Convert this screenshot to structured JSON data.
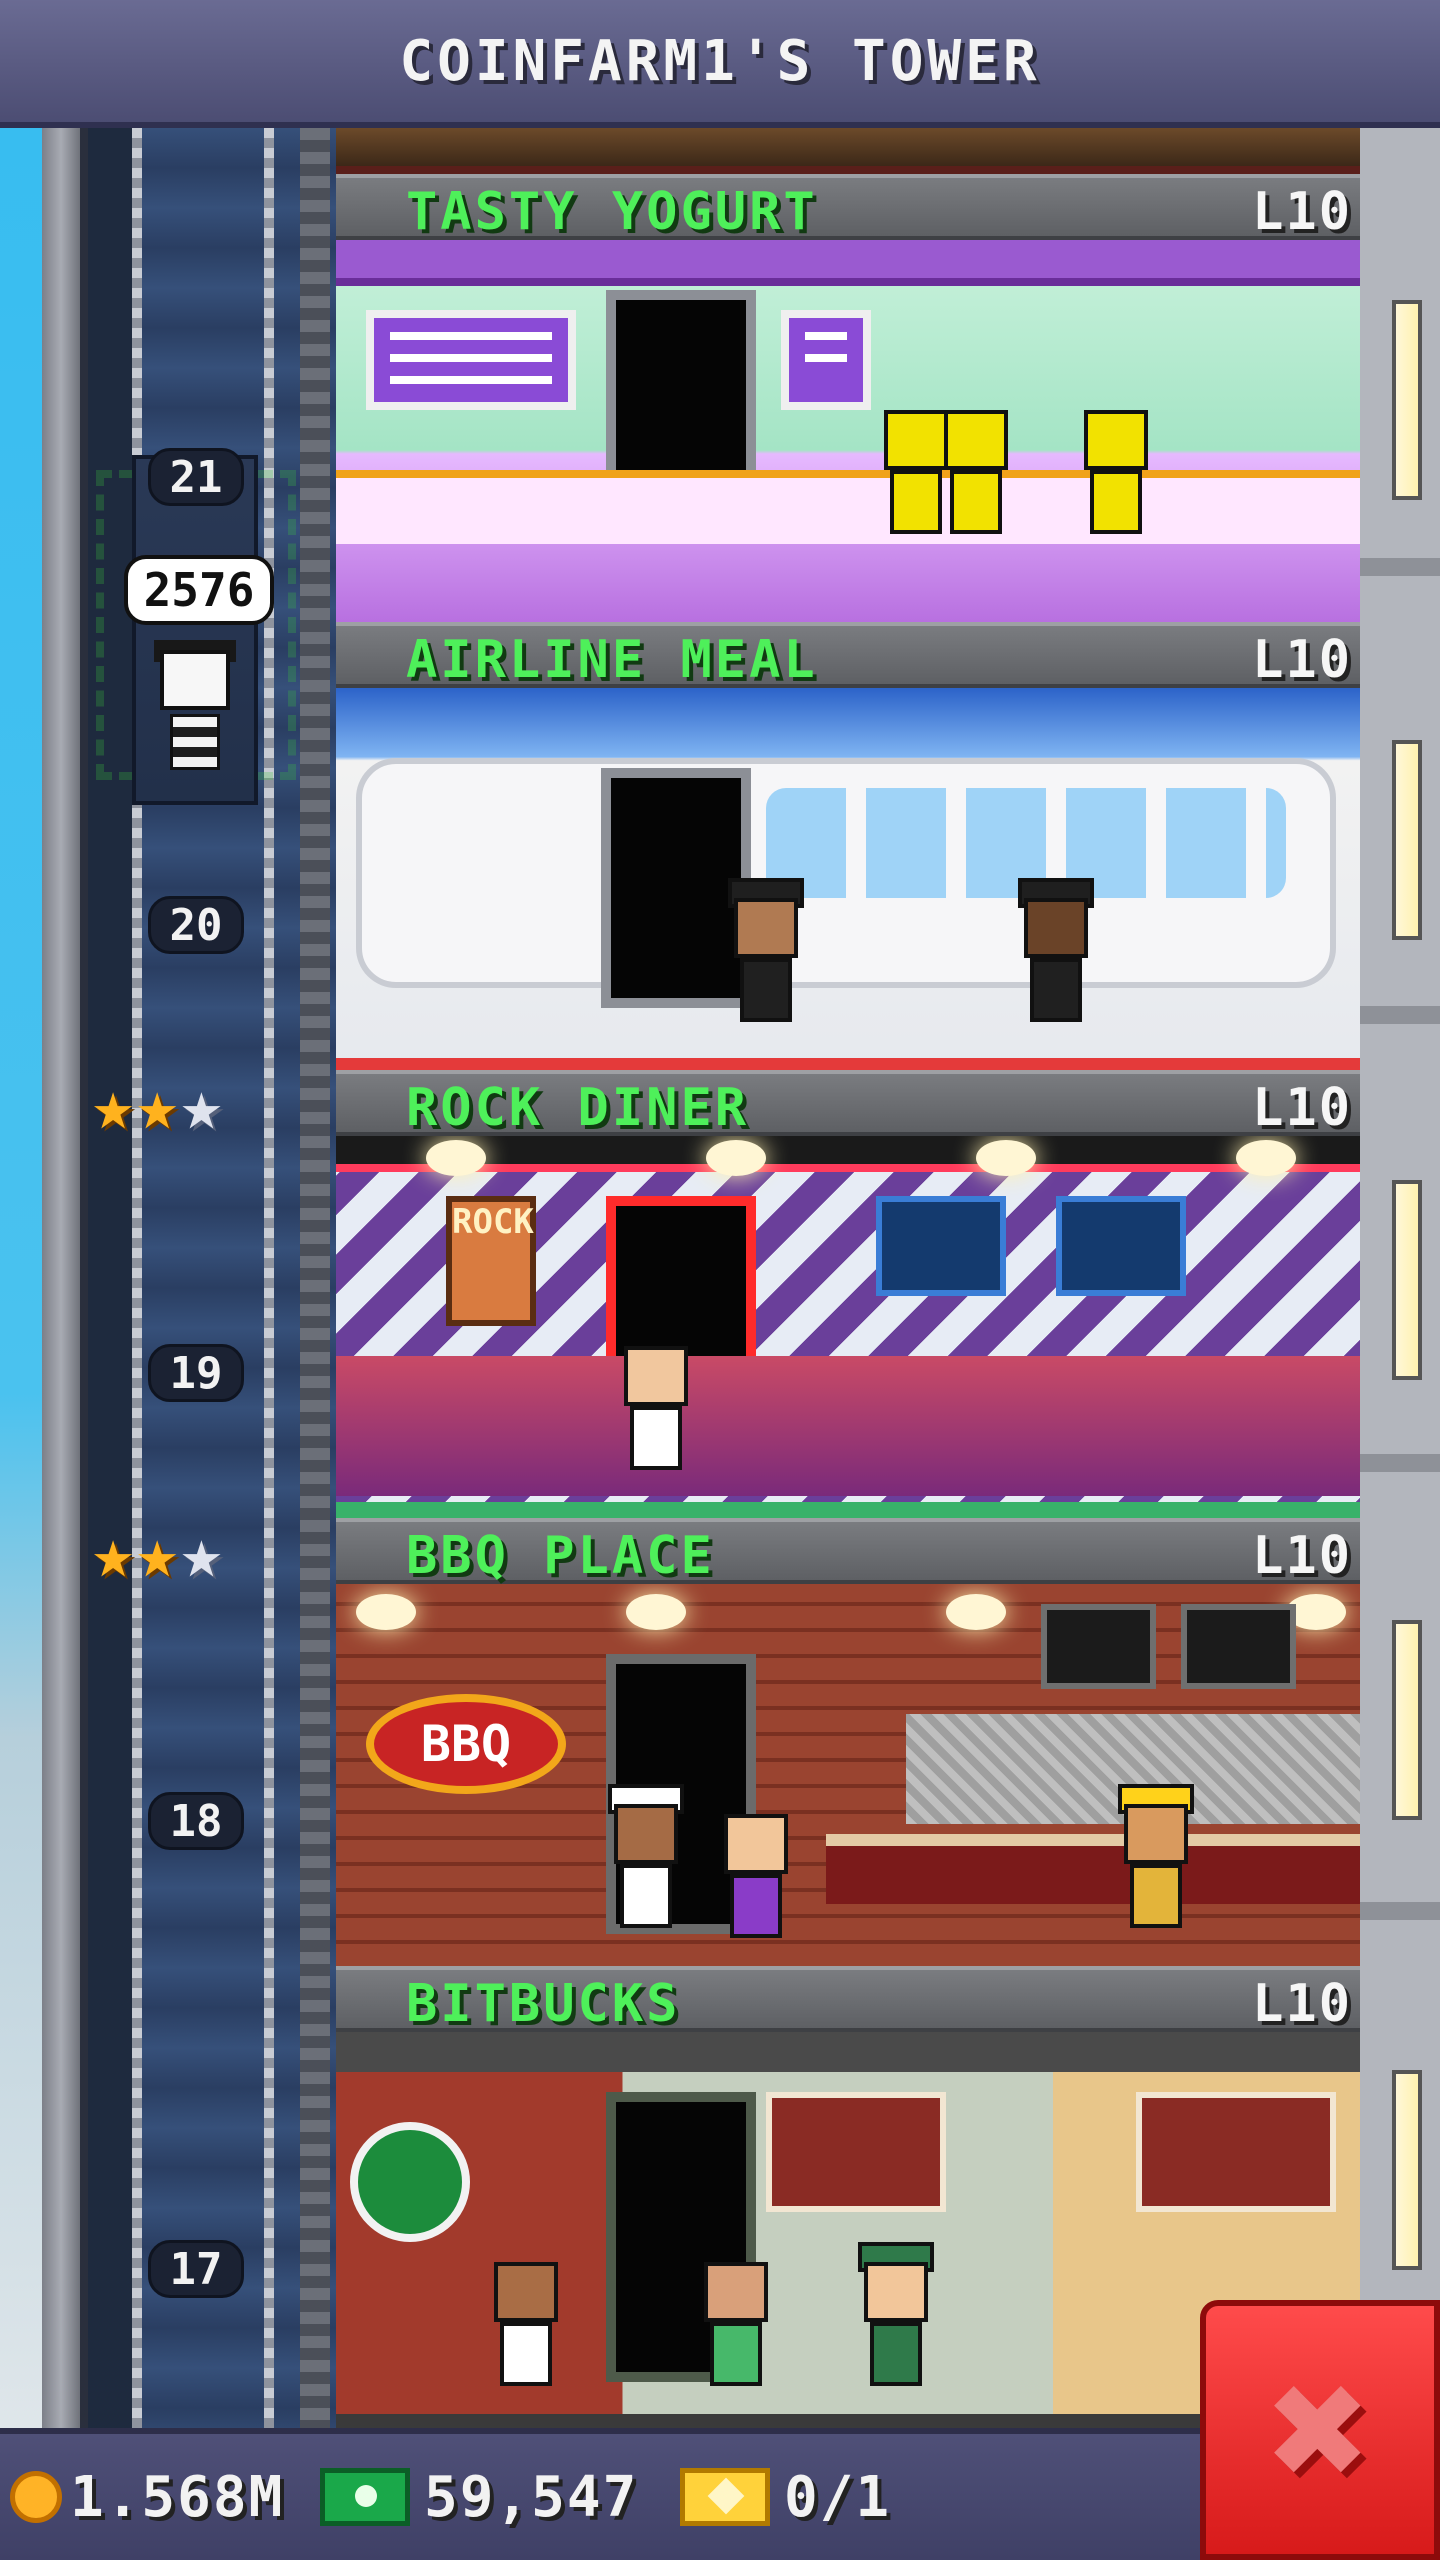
{
  "header": {
    "title": "COINFARM1'S TOWER"
  },
  "elevator": {
    "rider_count": "2576"
  },
  "floor_numbers": [
    "21",
    "20",
    "19",
    "18",
    "17"
  ],
  "floors": [
    {
      "name": "TASTY YOGURT",
      "level": "L10"
    },
    {
      "name": "AIRLINE MEAL",
      "level": "L10"
    },
    {
      "name": "ROCK DINER",
      "level": "L10"
    },
    {
      "name": "BBQ PLACE",
      "level": "L10"
    },
    {
      "name": "BITBUCKS",
      "level": "L10"
    }
  ],
  "signs": {
    "bbq": "BBQ",
    "rock": "ROCK"
  },
  "star_ratings": [
    {
      "gold": 2,
      "silver": 1
    },
    {
      "gold": 2,
      "silver": 1
    }
  ],
  "status_bar": {
    "coins": "1.568M",
    "bux": "59,547",
    "tickets": "0/1"
  },
  "colors": {
    "floor_name": "#4ef05a",
    "header_bg": "#5a5b82",
    "close_button": "#e12828"
  },
  "icons": {
    "coin": "coin-icon",
    "bux": "bux-icon",
    "ticket": "ticket-icon",
    "close": "close-icon",
    "star": "star-icon"
  }
}
